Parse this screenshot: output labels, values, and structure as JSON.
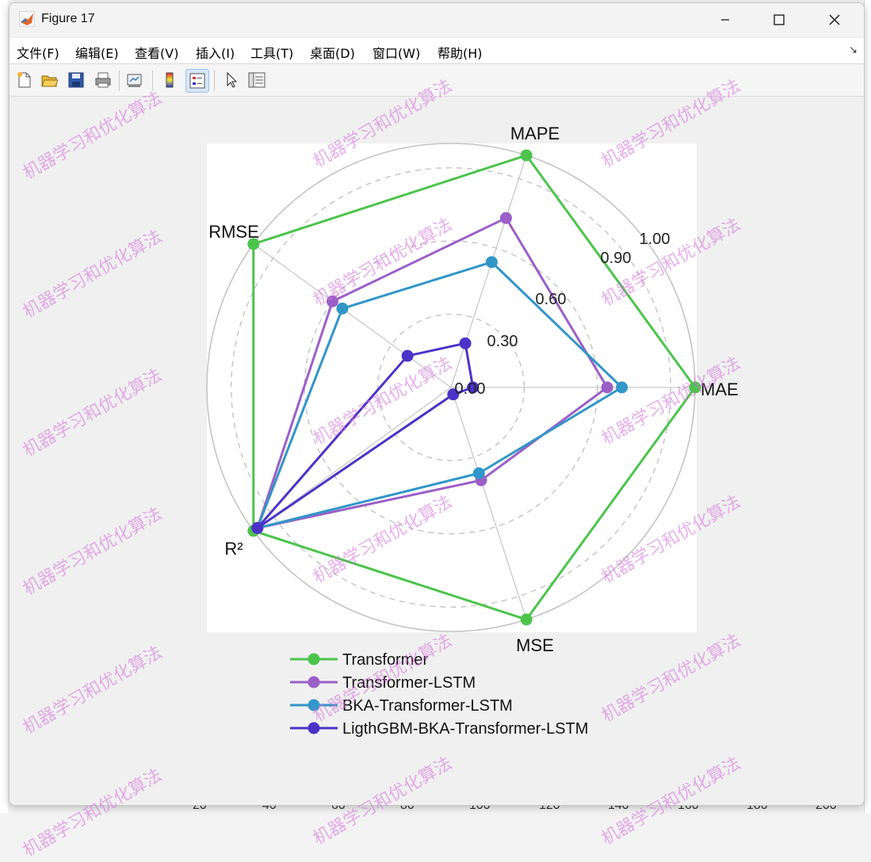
{
  "window": {
    "title": "Figure 17",
    "menu": [
      "文件(F)",
      "编辑(E)",
      "查看(V)",
      "插入(I)",
      "工具(T)",
      "桌面(D)",
      "窗口(W)",
      "帮助(H)"
    ]
  },
  "toolbar": {
    "icons": [
      "new-figure-icon",
      "open-icon",
      "save-icon",
      "print-icon",
      "link-icon",
      "colorbar-icon",
      "legend-icon",
      "pointer-icon",
      "property-inspector-icon"
    ]
  },
  "watermark_text": "机器学习和优化算法",
  "background_axis": [
    "20",
    "40",
    "60",
    "80",
    "100",
    "120",
    "140",
    "160",
    "180",
    "200"
  ],
  "chart_data": {
    "type": "radar",
    "axes": [
      "MAE",
      "MAPE",
      "RMSE",
      "R²",
      "MSE"
    ],
    "rlim": [
      0,
      1
    ],
    "tick_values": [
      0.3,
      0.6,
      0.9,
      1.0
    ],
    "tick_labels": [
      "0.30",
      "0.60",
      "0.90",
      "1.00"
    ],
    "center_label": "0.00",
    "grid": true,
    "legend_position": "bottom",
    "series": [
      {
        "name": "Transformer",
        "color": "#4cc44c",
        "values": [
          1.0,
          1.0,
          1.0,
          1.0,
          1.0
        ]
      },
      {
        "name": "Transformer-LSTM",
        "color": "#9b5fc8",
        "values": [
          0.64,
          0.73,
          0.6,
          0.98,
          0.4
        ]
      },
      {
        "name": "BKA-Transformer-LSTM",
        "color": "#3196c8",
        "values": [
          0.7,
          0.54,
          0.55,
          0.98,
          0.37
        ]
      },
      {
        "name": "LigthGBM-BKA-Transformer-LSTM",
        "color": "#4b33c8",
        "values": [
          0.09,
          0.19,
          0.22,
          0.98,
          0.03
        ]
      }
    ]
  }
}
